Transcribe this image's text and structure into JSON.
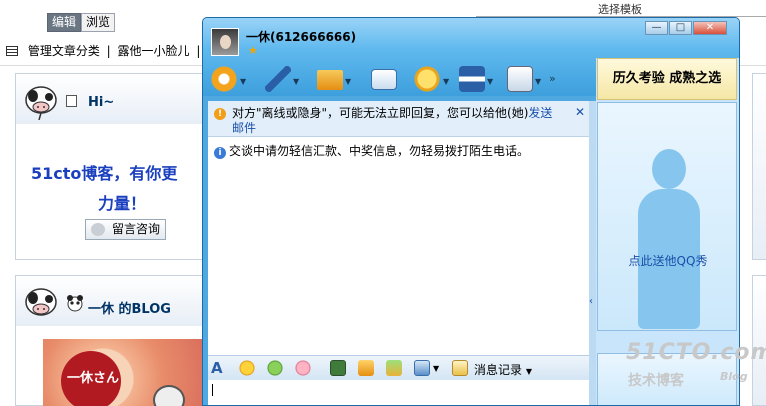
{
  "blog": {
    "tabs": [
      "编辑",
      "浏览"
    ],
    "menu": {
      "manage_label": "管理文章分类",
      "separator": "|",
      "moo_label": "露他一小脸儿",
      "separator2": "|"
    },
    "hi_title": "Hi~",
    "slogan_line1": "51cto博客，有你更",
    "slogan_line2": "力量！",
    "consult_button": "留言咨询",
    "blog_title": "一休 的BLOG",
    "photo_text": "一休さん"
  },
  "qq": {
    "contact_name": "一休(612666666)",
    "window_buttons": {
      "minimize": "—",
      "maximize": "□",
      "close": "✕"
    },
    "notice": {
      "text": "对方\"离线或隐身\"，可能无法立即回复，您可以给他(她)",
      "link": "发送邮件"
    },
    "warning": "交谈中请勿轻信汇款、中奖信息，勿轻易拨打陌生电话。",
    "history_label": "消息记录",
    "ad_text": "历久考验 成熟之选",
    "show_text": "点此送他QQ秀",
    "icons": [
      "video-icon",
      "mic-icon",
      "file-transfer-icon",
      "mail-icon",
      "chat-icon",
      "app-icon",
      "game-icon"
    ]
  },
  "watermark": {
    "line1": "51CTO.com",
    "line2": "技术博客",
    "line3": "Blog"
  },
  "topright_text": "选择模板"
}
